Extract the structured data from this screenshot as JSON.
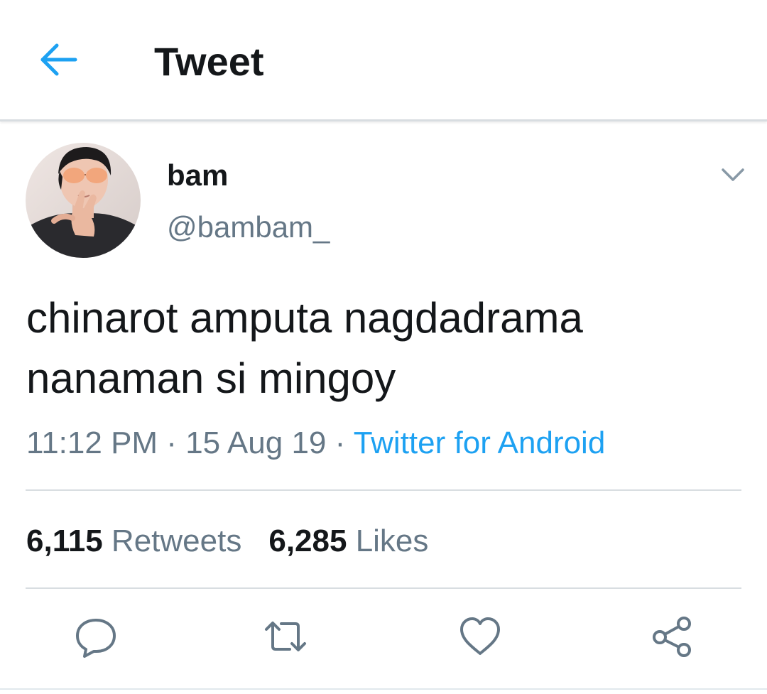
{
  "header": {
    "title": "Tweet",
    "back_icon": "arrow-left-icon"
  },
  "tweet": {
    "display_name": "bam",
    "handle": "@bambam_",
    "text": "chinarot amputa nagdadrama\nnanaman si mingoy",
    "time": "11:12 PM",
    "separator": " · ",
    "date": "15 Aug 19",
    "source": "Twitter for Android"
  },
  "stats": {
    "retweets_count": "6,115",
    "retweets_label": "Retweets",
    "likes_count": "6,285",
    "likes_label": "Likes"
  },
  "actions": [
    {
      "icon": "reply-icon"
    },
    {
      "icon": "retweet-icon"
    },
    {
      "icon": "heart-icon"
    },
    {
      "icon": "share-icon"
    }
  ],
  "colors": {
    "accent": "#1da1f2",
    "text_primary": "#14171a",
    "text_secondary": "#657786",
    "divider": "#d8dde1"
  }
}
